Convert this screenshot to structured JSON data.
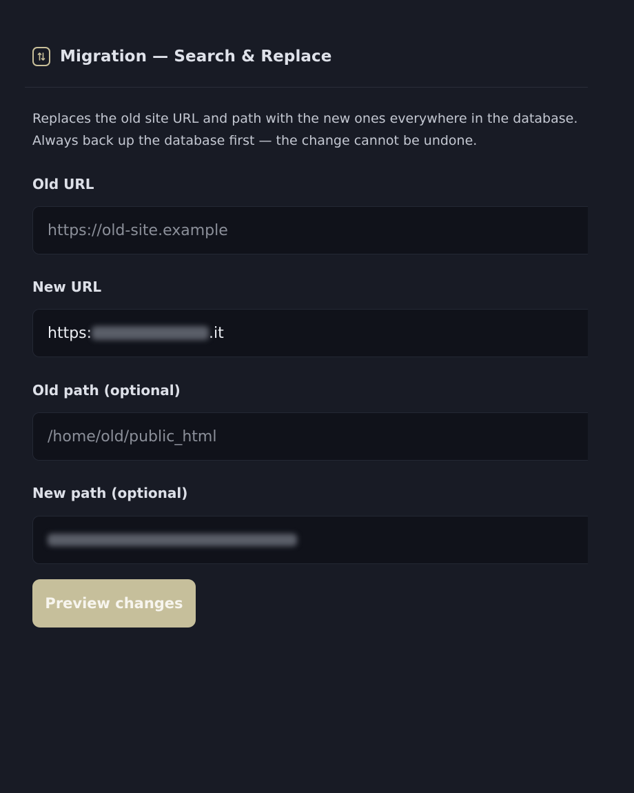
{
  "header": {
    "icon": "swap-vertical-icon",
    "title": "Migration — Search & Replace"
  },
  "description": "Replaces the old site URL and path with the new ones everywhere in the database. Always back up the database first — the change cannot be undone.",
  "fields": [
    {
      "label": "Old URL",
      "placeholder": "https://old-site.example",
      "value": ""
    },
    {
      "label": "New URL",
      "value_prefix": "https:",
      "value_suffix": ".it"
    },
    {
      "label": "Old path (optional)",
      "placeholder": "/home/old/public_html",
      "value": ""
    },
    {
      "label": "New path (optional)"
    }
  ],
  "preview_button": {
    "label": "Preview changes"
  },
  "colors": {
    "background": "#181b25",
    "input_background": "#10121a",
    "accent": "#c6bf9b"
  }
}
